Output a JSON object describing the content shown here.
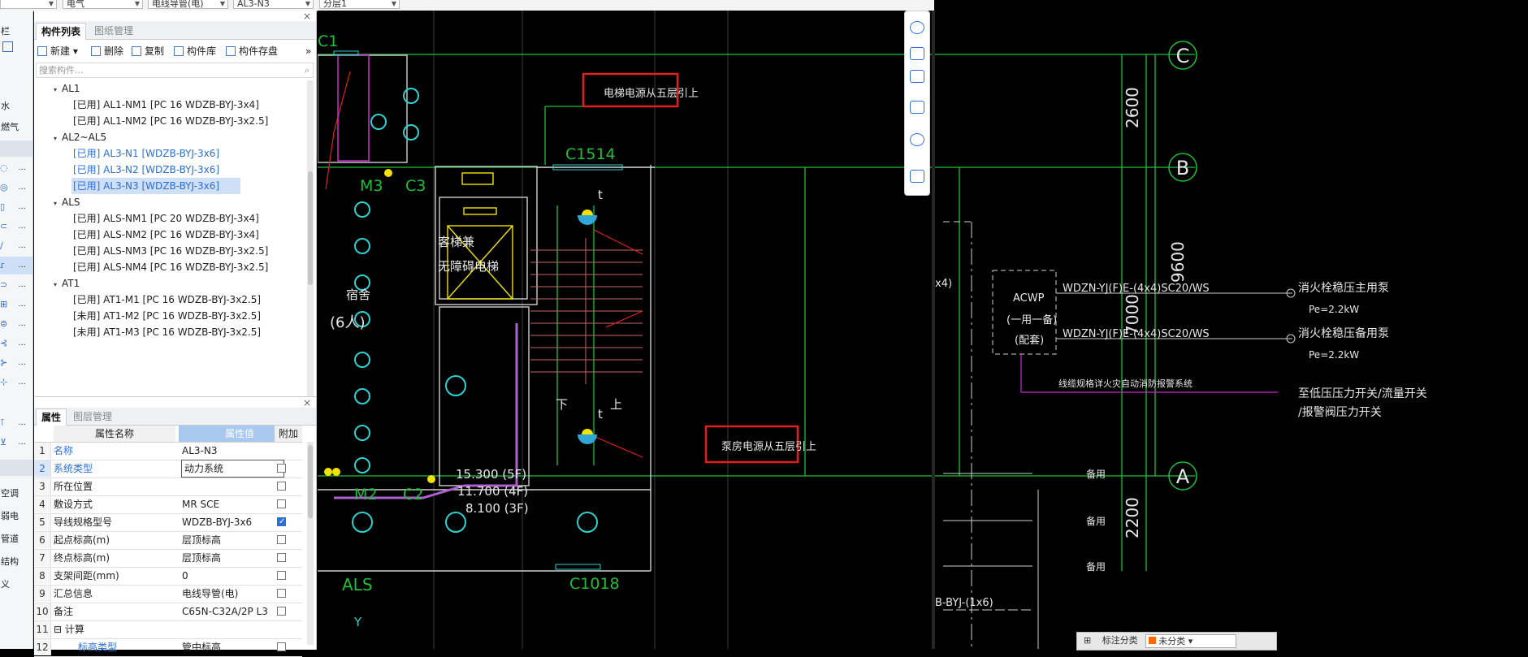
{
  "topbar": {
    "combos": [
      "",
      "电气",
      "电线导管(电)",
      "AL3-N3",
      "分层1"
    ]
  },
  "leftnav": {
    "text_items": [
      "栏",
      "水",
      "燃气",
      "空调",
      "弱电",
      "管道",
      "结构",
      "义"
    ],
    "icon_items": [
      "",
      "",
      "",
      "",
      "",
      "",
      "",
      "",
      "",
      "",
      "",
      ""
    ],
    "dots": "..."
  },
  "component_panel": {
    "tabs": [
      "构件列表",
      "图纸管理"
    ],
    "close": "×",
    "toolbar": {
      "new": "新建",
      "delete": "删除",
      "copy": "复制",
      "library": "构件库",
      "save": "构件存盘",
      "more": "»"
    },
    "search_placeholder": "搜索构件...",
    "tree": [
      {
        "type": "group",
        "label": "AL1"
      },
      {
        "type": "item",
        "label": "[已用] AL1-NM1 [PC 16 WDZB-BYJ-3x4]"
      },
      {
        "type": "item",
        "label": "[已用] AL1-NM2 [PC 16 WDZB-BYJ-3x2.5]"
      },
      {
        "type": "group",
        "label": "AL2~AL5"
      },
      {
        "type": "item",
        "label": "[已用] AL3-N1 [WDZB-BYJ-3x6]"
      },
      {
        "type": "item",
        "label": "[已用] AL3-N2 [WDZB-BYJ-3x6]"
      },
      {
        "type": "item",
        "label": "[已用] AL3-N3 [WDZB-BYJ-3x6]"
      },
      {
        "type": "group",
        "label": "ALS"
      },
      {
        "type": "item",
        "label": "[已用] ALS-NM1 [PC 20 WDZB-BYJ-3x4]"
      },
      {
        "type": "item",
        "label": "[已用] ALS-NM2 [PC 16 WDZB-BYJ-3x4]"
      },
      {
        "type": "item",
        "label": "[已用] ALS-NM3 [PC 16 WDZB-BYJ-3x2.5]"
      },
      {
        "type": "item",
        "label": "[已用] ALS-NM4 [PC 16 WDZB-BYJ-3x2.5]"
      },
      {
        "type": "group",
        "label": "AT1"
      },
      {
        "type": "item",
        "label": "[已用] AT1-M1 [PC 16 WDZB-BYJ-3x2.5]"
      },
      {
        "type": "item",
        "label": "[未用] AT1-M2 [PC 16 WDZB-BYJ-3x2.5]"
      },
      {
        "type": "item",
        "label": "[未用] AT1-M3 [PC 16 WDZB-BYJ-3x2.5]"
      }
    ]
  },
  "properties_panel": {
    "tabs": [
      "属性",
      "图层管理"
    ],
    "close": "×",
    "headers": [
      "属性名称",
      "属性值",
      "附加"
    ],
    "rows": [
      {
        "n": "1",
        "name": "名称",
        "value": "AL3-N3",
        "check": null
      },
      {
        "n": "2",
        "name": "系统类型",
        "value": "动力系统",
        "check": false
      },
      {
        "n": "3",
        "name": "所在位置",
        "value": "",
        "check": false
      },
      {
        "n": "4",
        "name": "敷设方式",
        "value": "MR SCE",
        "check": false
      },
      {
        "n": "5",
        "name": "导线规格型号",
        "value": "WDZB-BYJ-3x6",
        "check": true
      },
      {
        "n": "6",
        "name": "起点标高(m)",
        "value": "层顶标高",
        "check": false
      },
      {
        "n": "7",
        "name": "终点标高(m)",
        "value": "层顶标高",
        "check": false
      },
      {
        "n": "8",
        "name": "支架间距(mm)",
        "value": "0",
        "check": false
      },
      {
        "n": "9",
        "name": "汇总信息",
        "value": "电线导管(电)",
        "check": false
      },
      {
        "n": "10",
        "name": "备注",
        "value": "C65N-C32A/2P L3",
        "check": false
      },
      {
        "n": "11",
        "name": "⊟ 计算",
        "value": "",
        "check": null
      },
      {
        "n": "12",
        "name": "标高类型",
        "value": "管中标高",
        "check": false
      }
    ]
  },
  "cad": {
    "axis_labels": [
      "C",
      "B",
      "A"
    ],
    "dims": [
      "2600",
      "7000",
      "2200",
      "9600"
    ],
    "window_labels": [
      "C1514",
      "C1018",
      "C1"
    ],
    "door_labels": [
      "M3",
      "C3",
      "M2",
      "C2"
    ],
    "notes": [
      "电梯电源从五层引上",
      "泵房电源从五层引上"
    ],
    "room_labels": [
      "客梯兼",
      "无障碍电梯",
      "宿舍",
      "(6人)"
    ],
    "levels": [
      "15.300 (5F)",
      "11.700 (4F)",
      "8.100 (3F)"
    ],
    "stair": [
      "下",
      "上"
    ],
    "panel_name": "ALS",
    "t_label": "t",
    "axis_y": "Y",
    "schematic": {
      "box": [
        "ACWP",
        "(一用一备)",
        "(配套)"
      ],
      "lines": [
        {
          "cable": "WDZN-YJ(F)E-(4x4)SC20/WS",
          "load": "消火栓稳压主用泵",
          "power": "Pe=2.2kW"
        },
        {
          "cable": "WDZN-YJ(F)E-(4x4)SC20/WS",
          "load": "消火栓稳压备用泵",
          "power": "Pe=2.2kW"
        }
      ],
      "signal": "线缆规格详火灾自动消防报警系统",
      "signal_target": [
        "至低压压力开关/流量开关",
        "/报警阀压力开关"
      ],
      "spares": [
        "备用",
        "备用",
        "备用"
      ],
      "left_frag": [
        "x4)",
        "B-BYJ-(1x6)"
      ]
    }
  },
  "status": {
    "label": "标注分类",
    "value": "未分类"
  },
  "colors": {
    "accent": "#2a6fd6",
    "cad_bg": "#000000",
    "green": "#1fbf3a",
    "cyan": "#2fd0d0",
    "yellow": "#f1e200",
    "red": "#e02020"
  }
}
